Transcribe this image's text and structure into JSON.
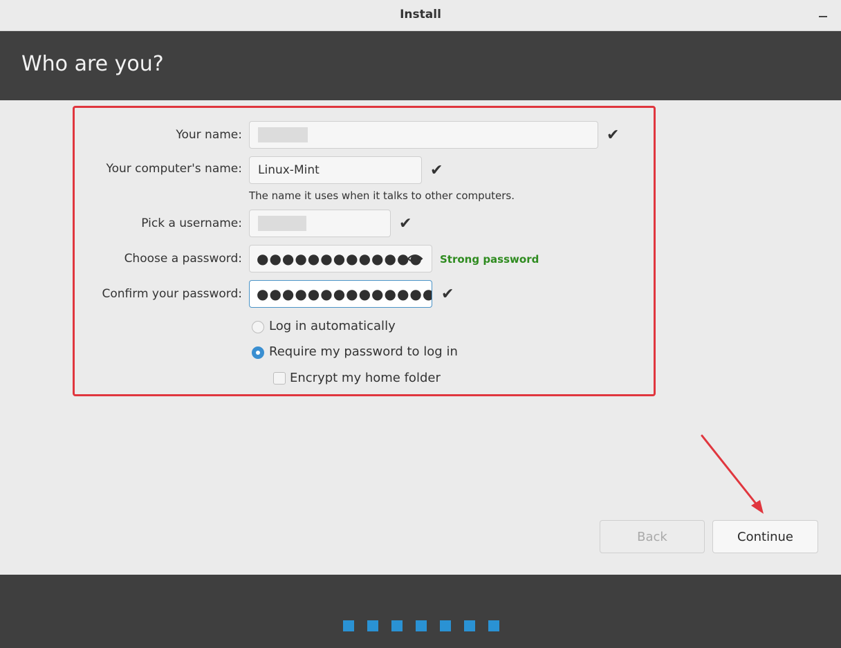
{
  "window": {
    "title": "Install"
  },
  "page": {
    "heading": "Who are you?"
  },
  "form": {
    "your_name_label": "Your name:",
    "computer_name_label": "Your computer's name:",
    "computer_name_value": "Linux-Mint",
    "computer_name_hint": "The name it uses when it talks to other computers.",
    "username_label": "Pick a username:",
    "password_label": "Choose a password:",
    "password_value": "●●●●●●●●●●●●●",
    "password_strength": "Strong password",
    "confirm_label": "Confirm your password:",
    "confirm_value": "●●●●●●●●●●●●●●",
    "login_auto_label": "Log in automatically",
    "require_password_label": "Require my password to log in",
    "encrypt_home_label": "Encrypt my home folder",
    "login_auto_selected": false,
    "require_password_selected": true,
    "encrypt_home_checked": false
  },
  "buttons": {
    "back": "Back",
    "continue": "Continue"
  },
  "progress": {
    "total_steps": 7
  },
  "colors": {
    "header_bg": "#404040",
    "accent": "#2a92d4",
    "highlight": "#e0363e",
    "strength": "#2e8b1f"
  },
  "icons": {
    "check": "check-icon",
    "eye": "eye-icon",
    "minimize": "minimize-icon",
    "arrow": "arrow-annotation"
  }
}
